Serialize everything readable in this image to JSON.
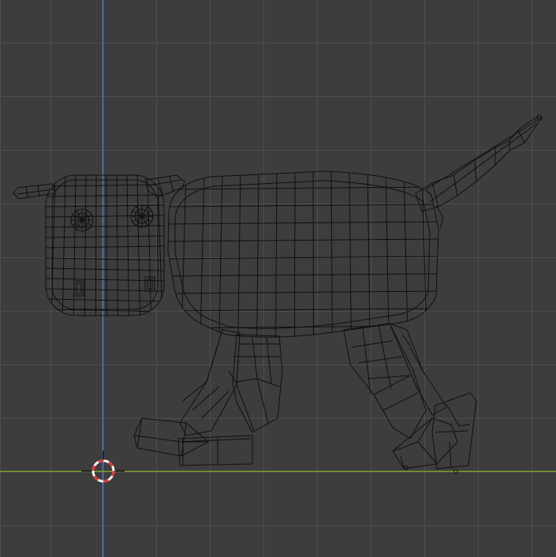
{
  "viewport": {
    "background": "#3d3d3d",
    "grid_color": "#4e4e4e",
    "wire_color": "#101010",
    "y_axis_color": "#4f7fc7",
    "x_axis_color": "#82a42f",
    "cursor_red": "#e03a3a"
  },
  "objects": [
    {
      "name": "head"
    },
    {
      "name": "ears"
    },
    {
      "name": "eyes"
    },
    {
      "name": "nostrils"
    },
    {
      "name": "body"
    },
    {
      "name": "tail"
    },
    {
      "name": "front-legs"
    },
    {
      "name": "back-legs"
    },
    {
      "name": "hooves"
    }
  ],
  "cursor": {
    "icon": "3d-cursor-icon"
  }
}
